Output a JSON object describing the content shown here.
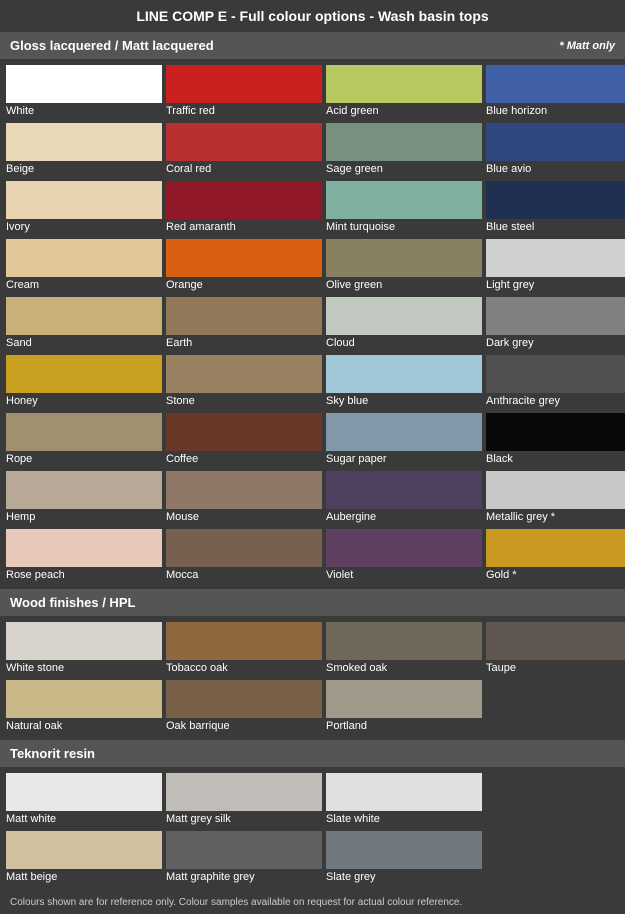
{
  "title": "LINE COMP E - Full colour options - Wash basin tops",
  "sections": {
    "gloss": {
      "header": "Gloss lacquered / Matt lacquered",
      "matt_only": "* Matt only",
      "colors": [
        {
          "label": "White",
          "class": "c-white"
        },
        {
          "label": "Traffic red",
          "class": "c-traffic-red"
        },
        {
          "label": "Acid green",
          "class": "c-acid-green"
        },
        {
          "label": "Blue horizon",
          "class": "c-blue-horizon"
        },
        {
          "label": "Beige",
          "class": "c-beige"
        },
        {
          "label": "Coral red",
          "class": "c-coral-red"
        },
        {
          "label": "Sage green",
          "class": "c-sage-green"
        },
        {
          "label": "Blue avio",
          "class": "c-blue-avio"
        },
        {
          "label": "Ivory",
          "class": "c-ivory"
        },
        {
          "label": "Red amaranth",
          "class": "c-red-amaranth"
        },
        {
          "label": "Mint turquoise",
          "class": "c-mint-turquoise"
        },
        {
          "label": "Blue steel",
          "class": "c-blue-steel"
        },
        {
          "label": "Cream",
          "class": "c-cream"
        },
        {
          "label": "Orange",
          "class": "c-orange"
        },
        {
          "label": "Olive green",
          "class": "c-olive-green"
        },
        {
          "label": "Light grey",
          "class": "c-light-grey"
        },
        {
          "label": "Sand",
          "class": "c-sand"
        },
        {
          "label": "Earth",
          "class": "c-earth"
        },
        {
          "label": "Cloud",
          "class": "c-cloud"
        },
        {
          "label": "Dark grey",
          "class": "c-dark-grey"
        },
        {
          "label": "Honey",
          "class": "c-honey"
        },
        {
          "label": "Stone",
          "class": "c-stone"
        },
        {
          "label": "Sky blue",
          "class": "c-sky-blue"
        },
        {
          "label": "Anthracite grey",
          "class": "c-anthracite-grey"
        },
        {
          "label": "Rope",
          "class": "c-rope"
        },
        {
          "label": "Coffee",
          "class": "c-coffee"
        },
        {
          "label": "Sugar paper",
          "class": "c-sugar-paper"
        },
        {
          "label": "Black",
          "class": "c-black"
        },
        {
          "label": "Hemp",
          "class": "c-hemp"
        },
        {
          "label": "Mouse",
          "class": "c-mouse"
        },
        {
          "label": "Aubergine",
          "class": "c-aubergine"
        },
        {
          "label": "Metallic grey *",
          "class": "c-metallic-grey"
        },
        {
          "label": "Rose peach",
          "class": "c-rose-peach"
        },
        {
          "label": "Mocca",
          "class": "c-mocca"
        },
        {
          "label": "Violet",
          "class": "c-violet"
        },
        {
          "label": "Gold *",
          "class": "c-gold"
        }
      ]
    },
    "wood": {
      "header": "Wood finishes / HPL",
      "colors": [
        {
          "label": "White stone",
          "class": "c-white-stone"
        },
        {
          "label": "Tobacco oak",
          "class": "c-tobacco-oak"
        },
        {
          "label": "Smoked oak",
          "class": "c-smoked-oak"
        },
        {
          "label": "Taupe",
          "class": "c-taupe"
        },
        {
          "label": "Natural oak",
          "class": "c-natural-oak"
        },
        {
          "label": "Oak barrique",
          "class": "c-oak-barrique"
        },
        {
          "label": "Portland",
          "class": "c-portland"
        },
        {
          "label": "",
          "class": ""
        }
      ]
    },
    "teknorit": {
      "header": "Teknorit resin",
      "colors": [
        {
          "label": "Matt white",
          "class": "c-matt-white"
        },
        {
          "label": "Matt grey silk",
          "class": "c-matt-grey-silk"
        },
        {
          "label": "Slate white",
          "class": "c-slate-white"
        },
        {
          "label": "",
          "class": ""
        },
        {
          "label": "Matt beige",
          "class": "c-matt-beige"
        },
        {
          "label": "Matt graphite grey",
          "class": "c-matt-graphite"
        },
        {
          "label": "Slate grey",
          "class": "c-slate-grey"
        },
        {
          "label": "",
          "class": ""
        }
      ]
    }
  },
  "footer": "Colours shown are for reference only. Colour samples available on request for actual colour reference."
}
